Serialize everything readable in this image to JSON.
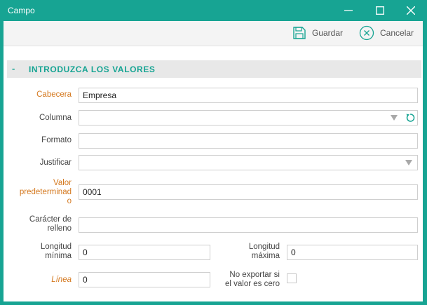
{
  "window": {
    "title": "Campo"
  },
  "toolbar": {
    "save_label": "Guardar",
    "cancel_label": "Cancelar"
  },
  "section": {
    "toggle": "-",
    "title": "INTRODUZCA LOS VALORES"
  },
  "fields": {
    "cabecera": {
      "label": "Cabecera",
      "value": "Empresa"
    },
    "columna": {
      "label": "Columna",
      "value": ""
    },
    "formato": {
      "label": "Formato",
      "value": ""
    },
    "justificar": {
      "label": "Justificar",
      "value": ""
    },
    "valor_predeterminado": {
      "label_line1": "Valor",
      "label_line2": "predeterminad",
      "label_line3": "o",
      "value": "0001"
    },
    "caracter_relleno": {
      "label_line1": "Carácter de",
      "label_line2": "relleno",
      "value": ""
    },
    "longitud_minima": {
      "label_line1": "Longitud",
      "label_line2": "mínima",
      "value": "0"
    },
    "longitud_maxima": {
      "label_line1": "Longitud",
      "label_line2": "máxima",
      "value": "0"
    },
    "linea": {
      "label": "Línea",
      "value": "0"
    },
    "no_exportar": {
      "label_line1": "No exportar si",
      "label_line2": "el valor es cero",
      "checked": false
    }
  },
  "colors": {
    "accent": "#17a493",
    "required_label": "#d4781e"
  },
  "icons": {
    "save": "save-icon",
    "cancel": "cancel-circle-icon",
    "refresh": "refresh-icon",
    "minimize": "minimize-icon",
    "maximize": "maximize-icon",
    "close": "close-icon"
  }
}
